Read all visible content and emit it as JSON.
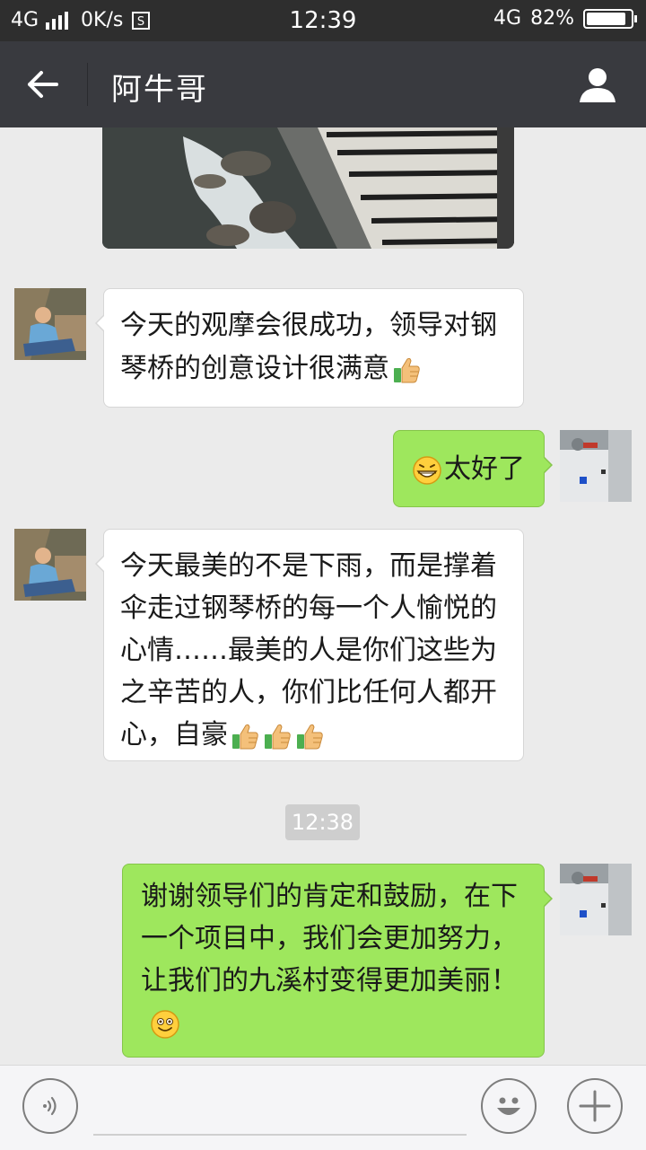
{
  "status_bar": {
    "network": "4G",
    "speed": "0K/s",
    "time": "12:39",
    "network_right": "4G",
    "battery_percent": "82%",
    "battery_level": 0.82
  },
  "header": {
    "title": "阿牛哥",
    "back_icon": "arrow-left-icon",
    "profile_icon": "person-icon"
  },
  "messages": [
    {
      "side": "left",
      "text": "今天的观摩会很成功，领导对钢琴桥的创意设计很满意",
      "emoji": "thumbs-up-icon"
    },
    {
      "side": "right",
      "emoji_before": "grin-icon",
      "text": "太好了"
    },
    {
      "side": "left",
      "text": "今天最美的不是下雨，而是撑着伞走过钢琴桥的每一个人愉悦的心情……最美的人是你们这些为之辛苦的人，你们比任何人都开心，自豪",
      "emoji": "thumbs-up-icon x3"
    },
    {
      "side": "right",
      "text": "谢谢领导们的肯定和鼓励，在下一个项目中，我们会更加努力，让我们的九溪村变得更加美丽！",
      "emoji": "smile-icon"
    }
  ],
  "timestamp": "12:38",
  "input_bar": {
    "voice_icon": "voice-icon",
    "emoji_icon": "smiley-face-icon",
    "plus_icon": "plus-icon"
  },
  "colors": {
    "status_bg": "#2e2e2e",
    "header_bg": "#393a3f",
    "chat_bg": "#ebebeb",
    "green_bubble": "#9ee75d",
    "white_bubble": "#ffffff"
  }
}
